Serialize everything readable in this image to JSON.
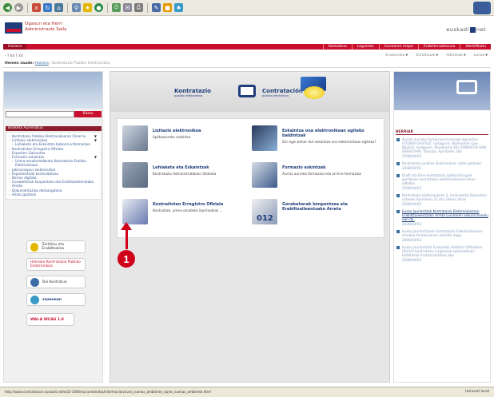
{
  "site": {
    "title_line1": "Ogasun eta Herri",
    "title_line2": "Administrazio Saila",
    "brand": "euskadi",
    "brand_suffix": "net"
  },
  "topnav": {
    "home": "Hasiera",
    "items": [
      "Kontaktua",
      "Laguntza",
      "Gunearen mapa",
      "Erabilerraztasuna",
      "Identifikatu"
    ]
  },
  "textsize": "- I xx I xx",
  "dropnav": [
    "Erakundea",
    "Zerbitzuak",
    "Albisteak",
    "Lanak"
  ],
  "breadcrumb": {
    "label": "Hemen zaude:",
    "home": "Hasiera",
    "current": "Kontratazio Publiko Elektronikoa"
  },
  "search": {
    "button": "Bilatu"
  },
  "left_menu": {
    "title": "Bilaketa Aurreratua",
    "items": [
      "Kontratazio Publiko Elektronikoaren Oinarria",
      "Lizitazio elektronikoa",
      "Lehiaketa eta Eskaintza bizkorra informazioa",
      "Kontratisten Erregistro Ofiziala",
      "Espedien Gaikuntza",
      "Formazio eskaintza",
      "Urena emaile/aldaketa Kontratazio Publiko Elektronikoan",
      "Jakinarazpen elektronikoa",
      "Espedienteak kontsultatzea",
      "Berme digitala",
      "Gorabeherak konpontzea eta Erabiltzaileentzako Arreta",
      "Dokumentazioa deskargatzea",
      "Aliatu gozteari"
    ],
    "buttons": [
      "Zerbitzu eta Erabiltzailea",
      "Hileroko Kontratazio Publiko Elektronikoa",
      "Bai Kontratua",
      "zuzenean",
      "WAI-A WCAG 1.0"
    ]
  },
  "hero": {
    "left": "Kontratazio",
    "left_sub": "publiko elektronikoa",
    "right": "Contratación",
    "right_sub": "pública electrónica"
  },
  "services": [
    {
      "title": "Lizitazio elektronikoa",
      "desc": "Aplikaziorako sarbidea"
    },
    {
      "title": "Eskaintza ona elektronikoan egiteko baldintzak",
      "desc": "Zer egin behar dut eskaintza era elektronikoan egiteko?"
    },
    {
      "title": "Lehiaketa eta Eskaintzak",
      "desc": "Kontratazio Administratiboen Sitaketa"
    },
    {
      "title": "Formazio eskintzak",
      "desc": "Aurrez aurreko formazioa eta on-line formazioa"
    },
    {
      "title": "Kontratisten Erregistro Ofiziala",
      "desc": "Kontsultak, urena emateko inprimakiak ..."
    },
    {
      "title": "Gorabeherak konpontzea eta Erabiltzaileentzako Arreta",
      "desc": ""
    }
  ],
  "service_badge": "012",
  "news": {
    "title": "BERRIAK",
    "items": [
      {
        "text": "Aurrez aurreko formazioa hurrengo egunetan: VITORIA-GASTEIZ: Gelagune, Bluenomm (Lev BELKA): Gelagune, Bluebrama Ets DONOSTIA-SAN SEBASTIAN, Tolosala, Apirilaren 16a",
        "date": "2008/04/03",
        "highlight": false
      },
      {
        "text": "Kontratazio publiko Elektronikoa: aleta gozteari",
        "date": "2008/04/03",
        "highlight": false
      },
      {
        "text": "Draft eta Bere kontratazio aplikazioa gure portalean kontratazio elektronikoaren lehen aldizkia",
        "date": "2008/04/03",
        "highlight": false
      },
      {
        "text": "Kontratazio Elektronikoko 3. lardunaldia Donostian usteeko Apirilaren 22 eta 24ean zehar",
        "date": "2008/04/03",
        "highlight": false
      },
      {
        "text": "Eusko Jaurlaritzak Kontratazio Elektronikoaren Erabiltzaileentzako Arreta Gunearen eskuna bandiu ean du.",
        "date": "2008/04/03",
        "highlight": true
      },
      {
        "text": "Eusko Jaurlaritzaren kontratazio Elektronikoaren sinadua Arratainanen ezarrita dago",
        "date": "2008/04/03",
        "highlight": false
      },
      {
        "text": "Eusko Jaurlaritzak Euskadiko Aldizkari Ofizialera (EHAA) kontratazio iragarkiak automatikoki bidaltzeko funtzionalitatea dau",
        "date": "2008/04/03",
        "highlight": false
      }
    ]
  },
  "status": {
    "url": "http://www.contratacion.euskadi.net/w32-1000/eu/contenidos/informacion/cons_suenas_ambiente_cip/es_suenas_ambiente.html",
    "zone": "Intranet local"
  },
  "callout": "1"
}
